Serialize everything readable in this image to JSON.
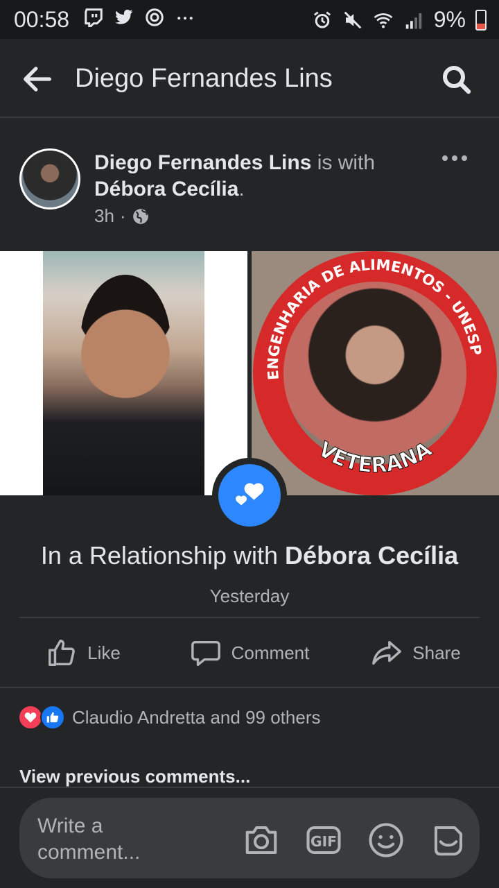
{
  "status_bar": {
    "time": "00:58",
    "battery": "9%",
    "left_icons": [
      "twitch-icon",
      "twitter-icon",
      "sync-icon",
      "more-dots-icon"
    ],
    "right_icons": [
      "alarm-icon",
      "mute-icon",
      "wifi-icon",
      "signal-icon",
      "battery-icon"
    ]
  },
  "header": {
    "title": "Diego Fernandes Lins"
  },
  "post": {
    "author": "Diego Fernandes Lins",
    "with_text": " is with",
    "tagged": "Débora Cecília",
    "tagged_suffix": ".",
    "time": "3h",
    "separator": "·"
  },
  "photo_right": {
    "ring_top": "ENGENHARIA DE ALIMENTOS - UNESP",
    "ring_bottom": "VETERANA"
  },
  "life_event": {
    "prefix": "In a Relationship with ",
    "partner": "Débora Cecília",
    "date": "Yesterday"
  },
  "actions": {
    "like": "Like",
    "comment": "Comment",
    "share": "Share"
  },
  "reactions": {
    "text": "Claudio Andretta and 99 others"
  },
  "comments": {
    "view_previous": "View previous comments...",
    "placeholder": "Write a comment..."
  },
  "colors": {
    "background": "#242526",
    "accent": "#2d88ff",
    "love": "#f33e58",
    "ring": "#d62a2a"
  }
}
